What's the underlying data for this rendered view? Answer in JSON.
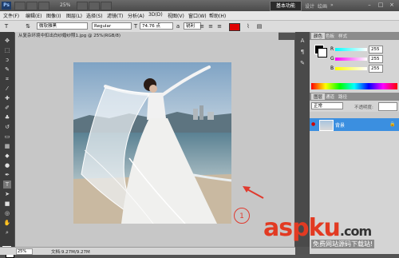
{
  "titlebar": {
    "logo": "Ps",
    "zoom": "25%",
    "workspace_button": "基本功能",
    "workspace_items": [
      "设计",
      "绘画",
      "»"
    ],
    "window_buttons": [
      "–",
      "□",
      "×"
    ]
  },
  "menu": [
    "文件(F)",
    "编辑(E)",
    "图像(I)",
    "图层(L)",
    "选择(S)",
    "滤镜(T)",
    "分析(A)",
    "3D(D)",
    "视图(V)",
    "窗口(W)",
    "帮助(H)"
  ],
  "options": {
    "font_family": "微软雅黑",
    "font_style": "Regular",
    "font_size": "74.76 点",
    "aa_mode": "锐利",
    "text_color": "#e00000"
  },
  "document": {
    "tab_title": "从复杂环境中扣出白纱婚纱照1.jpg @ 25%(RGB/8)"
  },
  "statusbar": {
    "zoom": "25%",
    "doc_info": "文档:9.27M/9.27M"
  },
  "panels": {
    "tabs": [
      "颜色",
      "色板",
      "样式"
    ],
    "sliders": [
      {
        "label": "R",
        "value": "255"
      },
      {
        "label": "G",
        "value": "255"
      },
      {
        "label": "B",
        "value": "255"
      }
    ],
    "layers_tabs": [
      "图层",
      "通道",
      "路径"
    ],
    "blend_mode": "正常",
    "opacity_label": "不透明度:",
    "layer_name": "背景",
    "lock_icon": "🔒"
  },
  "annotation": {
    "number": "1",
    "color": "#e03a2e"
  },
  "watermark": {
    "asp": "asp",
    "ku": "ku",
    "com": ".com",
    "sub": "免费网站源码下载站!"
  }
}
